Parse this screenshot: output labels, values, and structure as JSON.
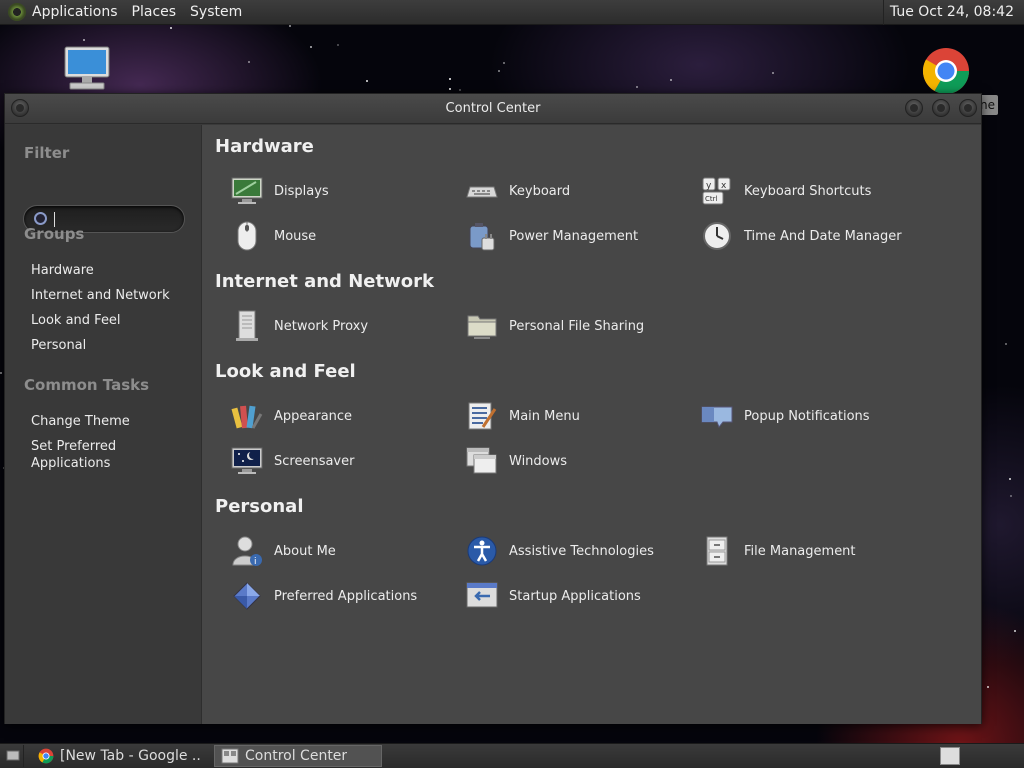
{
  "top_panel": {
    "menus": [
      "Applications",
      "Places",
      "System"
    ],
    "clock": "Tue Oct 24, 08:42"
  },
  "desktop": {
    "chrome_label_fragment": "ne"
  },
  "window": {
    "title": "Control Center"
  },
  "sidebar": {
    "filter_label": "Filter",
    "filter_value": "",
    "groups_label": "Groups",
    "groups": [
      "Hardware",
      "Internet and Network",
      "Look and Feel",
      "Personal"
    ],
    "common_tasks_label": "Common Tasks",
    "tasks": [
      "Change Theme",
      "Set Preferred Applications"
    ]
  },
  "sections": [
    {
      "title": "Hardware",
      "items": [
        {
          "label": "Displays",
          "icon": "display-icon"
        },
        {
          "label": "Keyboard",
          "icon": "keyboard-icon"
        },
        {
          "label": "Keyboard Shortcuts",
          "icon": "keyboard-shortcuts-icon"
        },
        {
          "label": "Mouse",
          "icon": "mouse-icon"
        },
        {
          "label": "Power Management",
          "icon": "power-management-icon"
        },
        {
          "label": "Time And Date Manager",
          "icon": "clock-icon"
        }
      ]
    },
    {
      "title": "Internet and Network",
      "items": [
        {
          "label": "Network Proxy",
          "icon": "network-proxy-icon"
        },
        {
          "label": "Personal File Sharing",
          "icon": "folder-share-icon"
        }
      ]
    },
    {
      "title": "Look and Feel",
      "items": [
        {
          "label": "Appearance",
          "icon": "appearance-icon"
        },
        {
          "label": "Main Menu",
          "icon": "main-menu-icon"
        },
        {
          "label": "Popup Notifications",
          "icon": "notification-icon"
        },
        {
          "label": "Screensaver",
          "icon": "screensaver-icon"
        },
        {
          "label": "Windows",
          "icon": "windows-icon"
        }
      ]
    },
    {
      "title": "Personal",
      "items": [
        {
          "label": "About Me",
          "icon": "about-me-icon"
        },
        {
          "label": "Assistive Technologies",
          "icon": "accessibility-icon"
        },
        {
          "label": "File Management",
          "icon": "file-cabinet-icon"
        },
        {
          "label": "Preferred Applications",
          "icon": "preferred-apps-icon"
        },
        {
          "label": "Startup Applications",
          "icon": "startup-apps-icon"
        }
      ]
    }
  ],
  "taskbar": {
    "tasks": [
      {
        "label": "[New Tab - Google ...",
        "active": false,
        "icon": "chrome-icon"
      },
      {
        "label": "Control Center",
        "active": true,
        "icon": "control-center-icon"
      }
    ]
  }
}
